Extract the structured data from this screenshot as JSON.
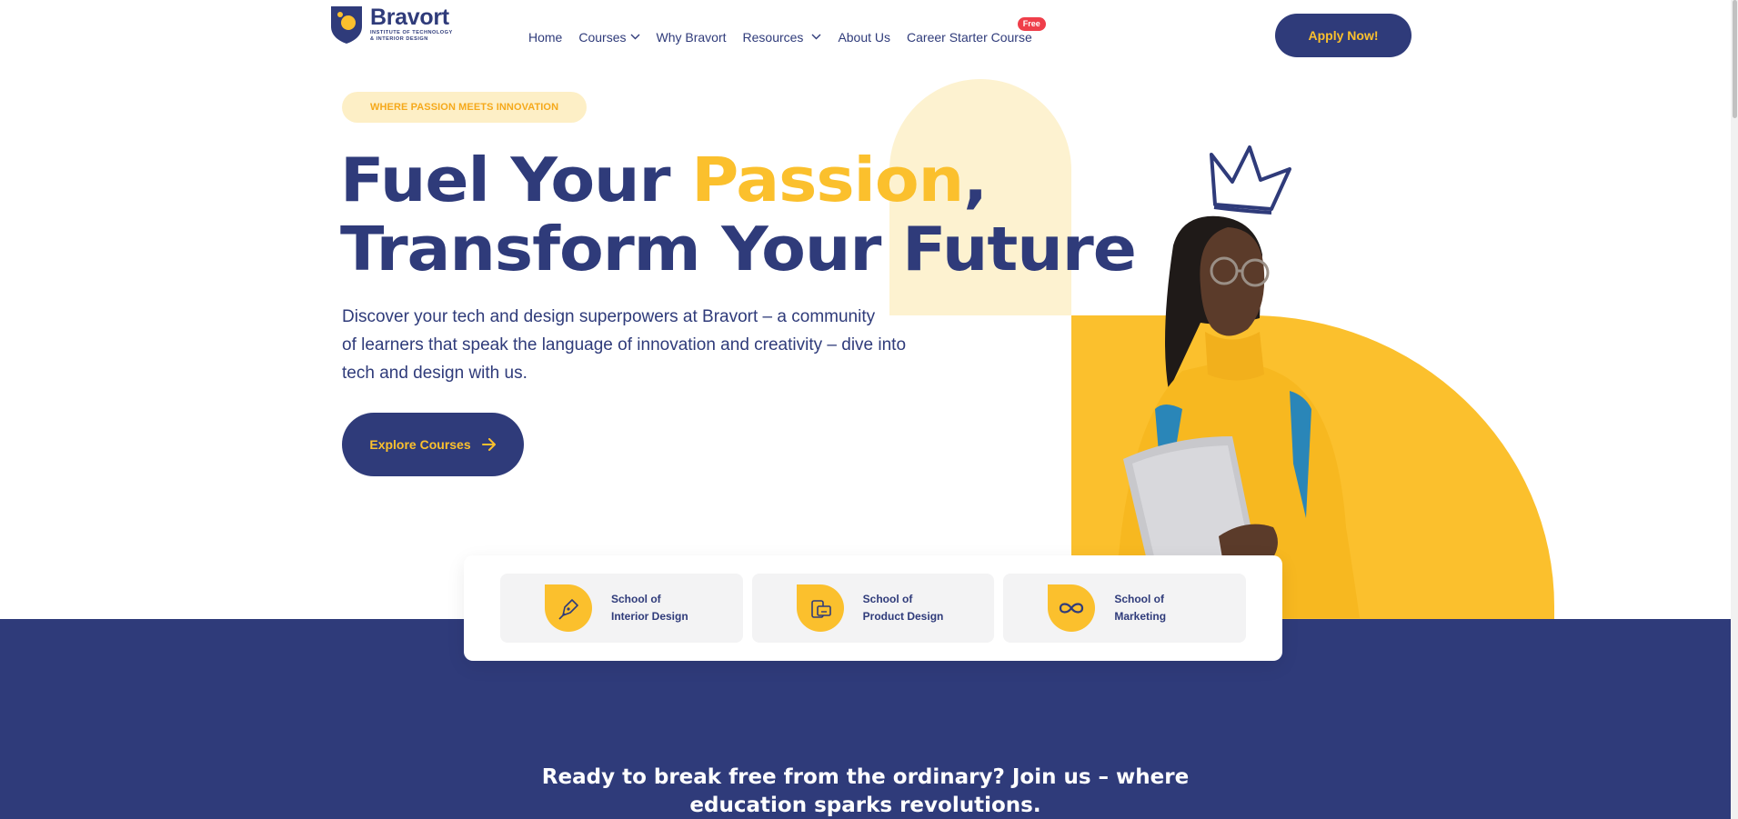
{
  "brand": {
    "name": "Bravort",
    "subtitle_line1": "INSTITUTE OF TECHNOLOGY",
    "subtitle_line2": "& INTERIOR DESIGN",
    "primary_color": "#2f3b7a",
    "accent_color": "#fbc02d"
  },
  "nav": {
    "items": [
      {
        "label": "Home",
        "dropdown": false
      },
      {
        "label": "Courses",
        "dropdown": true
      },
      {
        "label": "Why Bravort",
        "dropdown": false
      },
      {
        "label": "Resources",
        "dropdown": true
      },
      {
        "label": "About Us",
        "dropdown": false
      },
      {
        "label": "Career Starter Course",
        "dropdown": false,
        "badge": "Free"
      }
    ],
    "apply_label": "Apply Now!"
  },
  "hero": {
    "tagline": "WHERE PASSION MEETS INNOVATION",
    "headline_part1": "Fuel Your ",
    "headline_accent": "Passion",
    "headline_part2": ",",
    "headline_line2": "Transform Your Future",
    "intro_line1": "Discover your tech and design superpowers at Bravort – a community",
    "intro_line2": "of learners that speak the language of innovation and creativity – dive into",
    "intro_line3": "tech and design with us.",
    "cta_label": "Explore Courses",
    "cta_icon": "arrow-right-icon"
  },
  "schools": [
    {
      "line1": "School of",
      "line2": "Interior Design",
      "icon": "pen-nib-icon"
    },
    {
      "line1": "School of",
      "line2": "Product Design",
      "icon": "devices-icon"
    },
    {
      "line1": "School of",
      "line2": "Marketing",
      "icon": "infinity-link-icon"
    }
  ],
  "band": {
    "line1": "Ready to break free from the ordinary? Join us – where",
    "line2": "education sparks revolutions."
  }
}
